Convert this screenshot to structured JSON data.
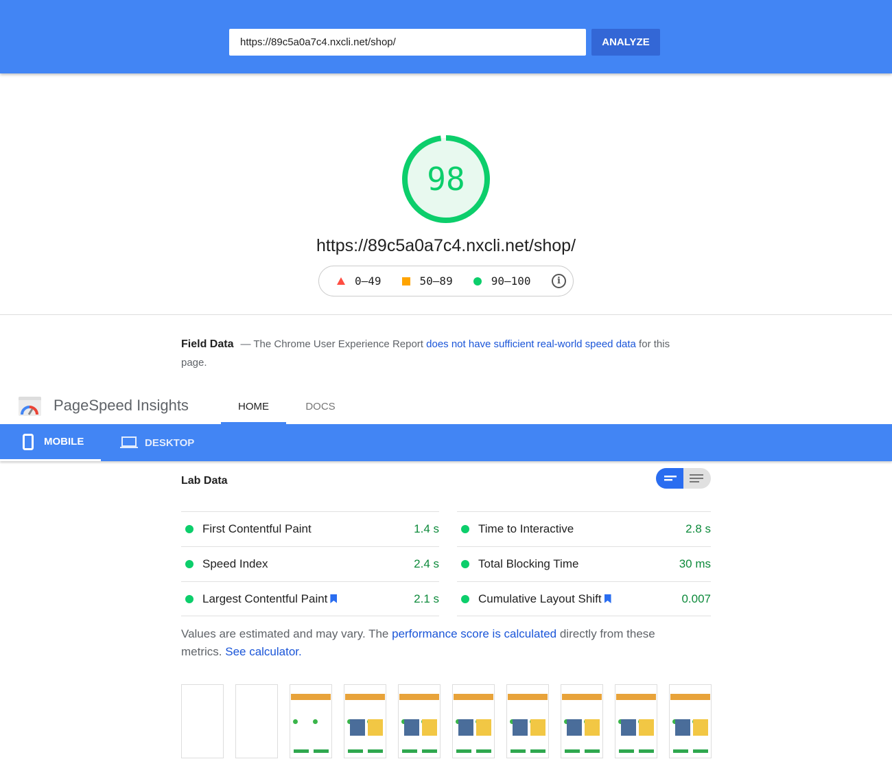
{
  "search": {
    "url": "https://89c5a0a7c4.nxcli.net/shop/",
    "analyze_label": "ANALYZE"
  },
  "score": {
    "value": 98,
    "fraction": 0.98,
    "color": "#0cce6b",
    "url": "https://89c5a0a7c4.nxcli.net/shop/"
  },
  "legend": {
    "fail": "0–49",
    "average": "50–89",
    "pass": "90–100"
  },
  "field_data": {
    "title": "Field Data",
    "prefix": "— The Chrome User Experience Report ",
    "link": "does not have sufficient real-world speed data",
    "suffix": " for this page."
  },
  "header": {
    "brand": "PageSpeed Insights",
    "tabs": [
      "HOME",
      "DOCS"
    ],
    "active_tab": "HOME"
  },
  "devices": {
    "mobile": "MOBILE",
    "desktop": "DESKTOP",
    "active": "MOBILE"
  },
  "lab": {
    "title": "Lab Data",
    "left": [
      {
        "label": "First Contentful Paint",
        "value": "1.4 s"
      },
      {
        "label": "Speed Index",
        "value": "2.4 s"
      },
      {
        "label": "Largest Contentful Paint",
        "value": "2.1 s"
      }
    ],
    "right": [
      {
        "label": "Time to Interactive",
        "value": "2.8 s"
      },
      {
        "label": "Total Blocking Time",
        "value": "30 ms"
      },
      {
        "label": "Cumulative Layout Shift",
        "value": "0.007"
      }
    ],
    "note_prefix": "Values are estimated and may vary. The ",
    "note_link": "performance score is calculated",
    "note_mid": " directly from these metrics. ",
    "note_link2": "See calculator."
  }
}
